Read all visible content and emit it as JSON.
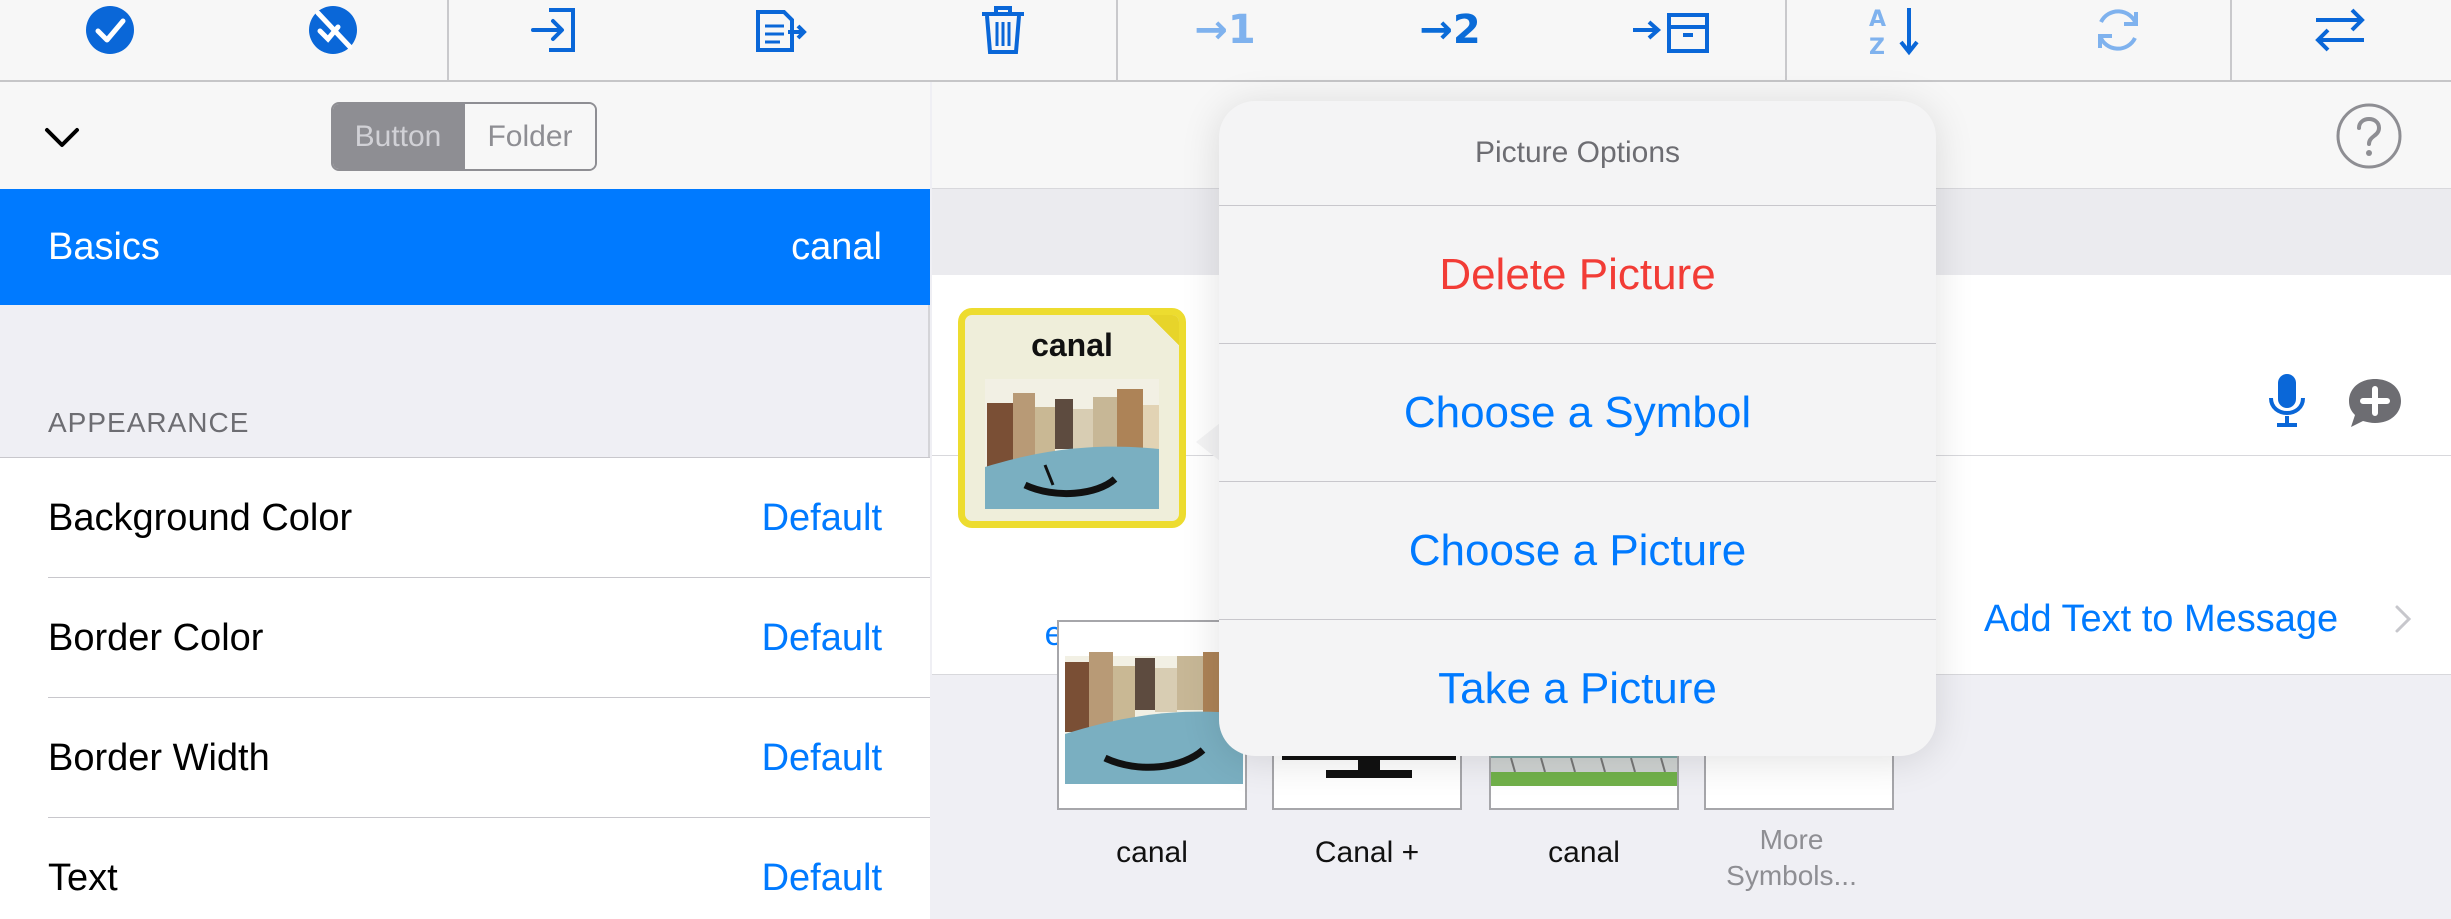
{
  "toolbar": {
    "items": [
      {
        "icon": "checkmark-circle-icon"
      },
      {
        "icon": "unselect-circle-icon"
      },
      {
        "icon": "move-in-icon"
      },
      {
        "icon": "paste-icon"
      },
      {
        "icon": "trash-icon"
      },
      {
        "icon": "arrow-to-1-icon",
        "label": "→1"
      },
      {
        "icon": "arrow-to-2-icon",
        "label": "→2"
      },
      {
        "icon": "arrow-to-archive-icon"
      },
      {
        "icon": "sort-az-icon"
      },
      {
        "icon": "refresh-icon"
      },
      {
        "icon": "swap-arrows-icon"
      }
    ]
  },
  "left_panel": {
    "segment": {
      "button": "Button",
      "folder": "Folder",
      "selected": "Button"
    },
    "basics": {
      "label": "Basics",
      "value": "canal"
    },
    "appearance_header": "APPEARANCE",
    "rows": [
      {
        "label": "Background Color",
        "value": "Default"
      },
      {
        "label": "Border Color",
        "value": "Default"
      },
      {
        "label": "Border Width",
        "value": "Default"
      },
      {
        "label": "Text",
        "value": "Default"
      }
    ]
  },
  "right_panel": {
    "tile": {
      "label": "canal",
      "edit": "edit"
    },
    "add_text": "Add Text to Message",
    "symbols": [
      {
        "label": "canal"
      },
      {
        "label": "Canal +"
      },
      {
        "label": "canal"
      },
      {
        "label": "More Symbols..."
      }
    ]
  },
  "popover": {
    "title": "Picture Options",
    "items": [
      {
        "label": "Delete Picture",
        "destructive": true
      },
      {
        "label": "Choose a Symbol"
      },
      {
        "label": "Choose a Picture"
      },
      {
        "label": "Take a Picture"
      }
    ]
  },
  "colors": {
    "accent": "#007aff",
    "destructive": "#f23c36",
    "tile_border": "#eddc2f"
  }
}
